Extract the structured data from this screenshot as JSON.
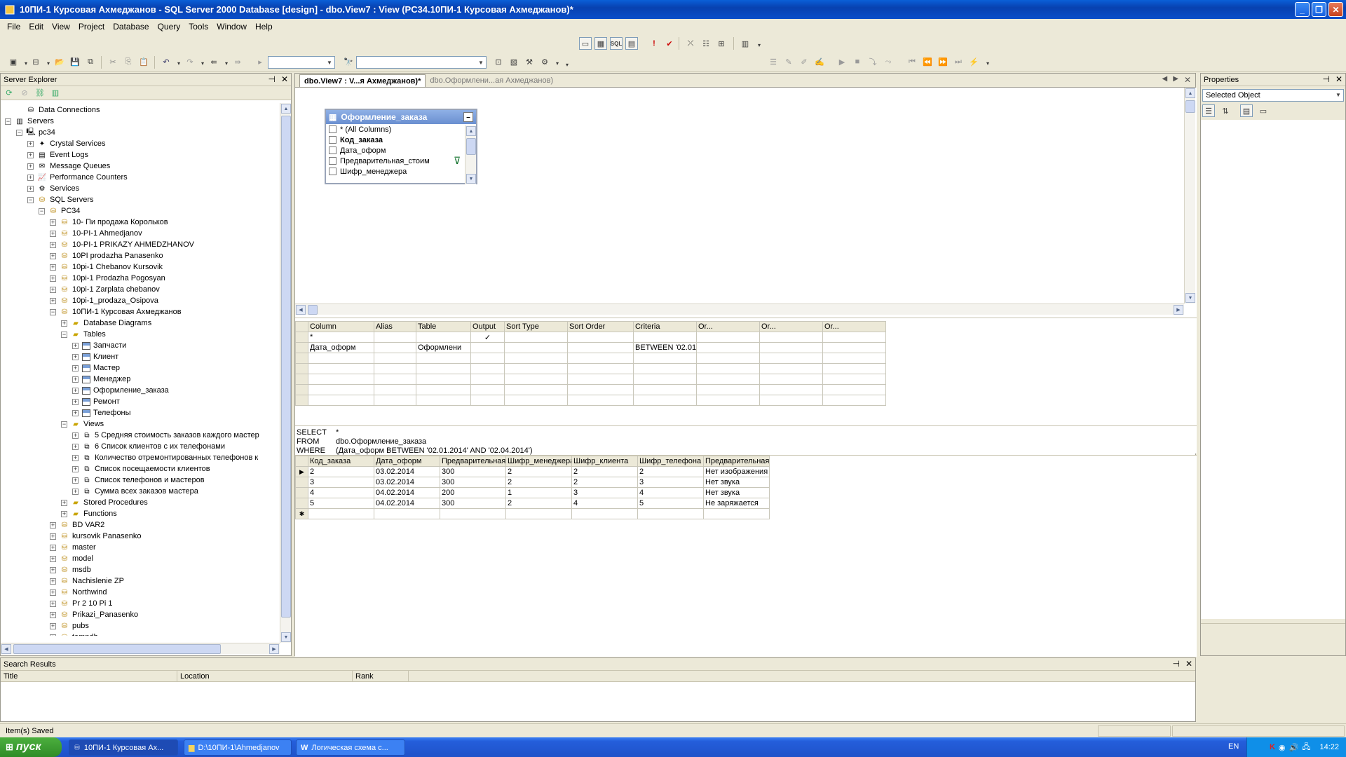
{
  "window": {
    "title": "10ПИ-1 Курсовая Ахмеджанов - SQL Server 2000 Database [design] - dbo.View7 : View (PC34.10ПИ-1 Курсовая Ахмеджанов)*"
  },
  "menu": [
    "File",
    "Edit",
    "View",
    "Project",
    "Database",
    "Query",
    "Tools",
    "Window",
    "Help"
  ],
  "server_explorer": {
    "title": "Server Explorer",
    "tree": [
      {
        "label": "Data Connections",
        "level": 1,
        "icon": "data-connections-icon",
        "expander": ""
      },
      {
        "label": "Servers",
        "level": 0,
        "icon": "servers-icon",
        "expander": "−"
      },
      {
        "label": "pc34",
        "level": 1,
        "icon": "computer-icon",
        "expander": "−"
      },
      {
        "label": "Crystal Services",
        "level": 2,
        "icon": "crystal-icon",
        "expander": "+"
      },
      {
        "label": "Event Logs",
        "level": 2,
        "icon": "event-log-icon",
        "expander": "+"
      },
      {
        "label": "Message Queues",
        "level": 2,
        "icon": "message-queue-icon",
        "expander": "+"
      },
      {
        "label": "Performance Counters",
        "level": 2,
        "icon": "performance-icon",
        "expander": "+"
      },
      {
        "label": "Services",
        "level": 2,
        "icon": "services-icon",
        "expander": "+"
      },
      {
        "label": "SQL Servers",
        "level": 2,
        "icon": "sql-servers-icon",
        "expander": "−"
      },
      {
        "label": "PC34",
        "level": 3,
        "icon": "sql-server-icon",
        "expander": "−"
      },
      {
        "label": "10- Пи продажа Корольков",
        "level": 4,
        "icon": "database-icon",
        "expander": "+"
      },
      {
        "label": "10-PI-1 Ahmedjanov",
        "level": 4,
        "icon": "database-icon",
        "expander": "+"
      },
      {
        "label": "10-PI-1 PRIKAZY AHMEDZHANOV",
        "level": 4,
        "icon": "database-icon",
        "expander": "+"
      },
      {
        "label": "10PI prodazha Panasenko",
        "level": 4,
        "icon": "database-icon",
        "expander": "+"
      },
      {
        "label": "10pi-1 Chebanov Kursovik",
        "level": 4,
        "icon": "database-icon",
        "expander": "+"
      },
      {
        "label": "10pi-1 Prodazha Pogosyan",
        "level": 4,
        "icon": "database-icon",
        "expander": "+"
      },
      {
        "label": "10pi-1 Zarplata chebanov",
        "level": 4,
        "icon": "database-icon",
        "expander": "+"
      },
      {
        "label": "10pi-1_prodaza_Osipova",
        "level": 4,
        "icon": "database-icon",
        "expander": "+"
      },
      {
        "label": "10ПИ-1 Курсовая Ахмеджанов",
        "level": 4,
        "icon": "database-icon",
        "expander": "−"
      },
      {
        "label": "Database Diagrams",
        "level": 5,
        "icon": "folder-icon",
        "expander": "+"
      },
      {
        "label": "Tables",
        "level": 5,
        "icon": "folder-icon",
        "expander": "−"
      },
      {
        "label": "Запчасти",
        "level": 6,
        "icon": "table-icon",
        "expander": "+"
      },
      {
        "label": "Клиент",
        "level": 6,
        "icon": "table-icon",
        "expander": "+"
      },
      {
        "label": "Мастер",
        "level": 6,
        "icon": "table-icon",
        "expander": "+"
      },
      {
        "label": "Менеджер",
        "level": 6,
        "icon": "table-icon",
        "expander": "+"
      },
      {
        "label": "Оформление_заказа",
        "level": 6,
        "icon": "table-icon",
        "expander": "+"
      },
      {
        "label": "Ремонт",
        "level": 6,
        "icon": "table-icon",
        "expander": "+"
      },
      {
        "label": "Телефоны",
        "level": 6,
        "icon": "table-icon",
        "expander": "+"
      },
      {
        "label": "Views",
        "level": 5,
        "icon": "folder-icon",
        "expander": "−"
      },
      {
        "label": "5 Средняя стоимость заказов каждого мастер",
        "level": 6,
        "icon": "view-icon",
        "expander": "+"
      },
      {
        "label": "6 Список клиентов с их телефонами",
        "level": 6,
        "icon": "view-icon",
        "expander": "+"
      },
      {
        "label": "Количество отремонтированных телефонов к",
        "level": 6,
        "icon": "view-icon",
        "expander": "+"
      },
      {
        "label": "Список посещаемости клиентов",
        "level": 6,
        "icon": "view-icon",
        "expander": "+"
      },
      {
        "label": "Список телефонов и мастеров",
        "level": 6,
        "icon": "view-icon",
        "expander": "+"
      },
      {
        "label": "Сумма всех заказов мастера",
        "level": 6,
        "icon": "view-icon",
        "expander": "+"
      },
      {
        "label": "Stored Procedures",
        "level": 5,
        "icon": "folder-icon",
        "expander": "+"
      },
      {
        "label": "Functions",
        "level": 5,
        "icon": "folder-icon",
        "expander": "+"
      },
      {
        "label": "BD VAR2",
        "level": 4,
        "icon": "database-icon",
        "expander": "+"
      },
      {
        "label": "kursovik Panasenko",
        "level": 4,
        "icon": "database-icon",
        "expander": "+"
      },
      {
        "label": "master",
        "level": 4,
        "icon": "database-icon",
        "expander": "+"
      },
      {
        "label": "model",
        "level": 4,
        "icon": "database-icon",
        "expander": "+"
      },
      {
        "label": "msdb",
        "level": 4,
        "icon": "database-icon",
        "expander": "+"
      },
      {
        "label": "Nachislenie ZP",
        "level": 4,
        "icon": "database-icon",
        "expander": "+"
      },
      {
        "label": "Northwind",
        "level": 4,
        "icon": "database-icon",
        "expander": "+"
      },
      {
        "label": "Pr 2 10 Pi 1",
        "level": 4,
        "icon": "database-icon",
        "expander": "+"
      },
      {
        "label": "Prikazi_Panasenko",
        "level": 4,
        "icon": "database-icon",
        "expander": "+"
      },
      {
        "label": "pubs",
        "level": 4,
        "icon": "database-icon",
        "expander": "+"
      },
      {
        "label": "tempdb",
        "level": 4,
        "icon": "database-icon",
        "expander": "+"
      }
    ]
  },
  "tabs": [
    {
      "label": "dbo.View7 : V...я Ахмеджанов)*",
      "active": true
    },
    {
      "label": "dbo.Оформлени...ая Ахмеджанов)",
      "active": false
    }
  ],
  "diagram_table": {
    "title": "Оформление_заказа",
    "columns": [
      {
        "label": "* (All Columns)",
        "bold": false
      },
      {
        "label": "Код_заказа",
        "bold": true
      },
      {
        "label": "Дата_оформ",
        "bold": false
      },
      {
        "label": "Предварительная_стоим",
        "bold": false
      },
      {
        "label": "Шифр_менеджера",
        "bold": false
      }
    ]
  },
  "criteria_grid": {
    "headers": [
      "Column",
      "Alias",
      "Table",
      "Output",
      "Sort Type",
      "Sort Order",
      "Criteria",
      "Or...",
      "Or...",
      "Or..."
    ],
    "rows": [
      [
        "*",
        "",
        "",
        "✓",
        "",
        "",
        "",
        "",
        "",
        ""
      ],
      [
        "Дата_оформ",
        "",
        "Оформлени",
        "",
        "",
        "",
        "BETWEEN '02.01.",
        "",
        "",
        ""
      ],
      [
        "",
        "",
        "",
        "",
        "",
        "",
        "",
        "",
        "",
        ""
      ],
      [
        "",
        "",
        "",
        "",
        "",
        "",
        "",
        "",
        "",
        ""
      ],
      [
        "",
        "",
        "",
        "",
        "",
        "",
        "",
        "",
        "",
        ""
      ],
      [
        "",
        "",
        "",
        "",
        "",
        "",
        "",
        "",
        "",
        ""
      ],
      [
        "",
        "",
        "",
        "",
        "",
        "",
        "",
        "",
        "",
        ""
      ]
    ]
  },
  "sql": {
    "select_kw": "SELECT",
    "select_val": "*",
    "from_kw": "FROM",
    "from_val": "dbo.Оформление_заказа",
    "where_kw": "WHERE",
    "where_val": "(Дата_оформ BETWEEN '02.01.2014' AND '02.04.2014')"
  },
  "results": {
    "headers": [
      "Код_заказа",
      "Дата_оформ",
      "Предварительная",
      "Шифр_менеджера",
      "Шифр_клиента",
      "Шифр_телефона",
      "Предварительная"
    ],
    "rows": [
      [
        "2",
        "03.02.2014",
        "300",
        "2",
        "2",
        "2",
        "Нет изображения"
      ],
      [
        "3",
        "03.02.2014",
        "300",
        "2",
        "2",
        "3",
        "Нет звука"
      ],
      [
        "4",
        "04.02.2014",
        "200",
        "1",
        "3",
        "4",
        "Нет звука"
      ],
      [
        "5",
        "04.02.2014",
        "300",
        "2",
        "4",
        "5",
        "Не заряжается"
      ],
      [
        "",
        "",
        "",
        "",
        "",
        "",
        ""
      ]
    ]
  },
  "properties": {
    "title": "Properties",
    "selected": "Selected Object"
  },
  "search_results": {
    "title": "Search Results",
    "columns": [
      "Title",
      "Location",
      "Rank"
    ]
  },
  "status": {
    "text": "Item(s) Saved"
  },
  "taskbar": {
    "start": "пуск",
    "tasks": [
      "10ПИ-1 Курсовая Ах...",
      "D:\\10ПИ-1\\Ahmedjanov",
      "Логическая схема с..."
    ],
    "lang": "EN",
    "clock": "14:22"
  }
}
